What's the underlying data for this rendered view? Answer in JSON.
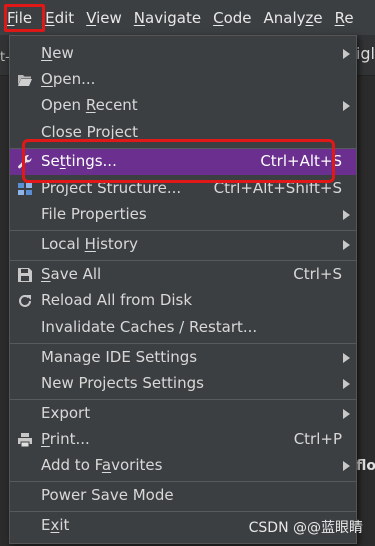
{
  "menubar": {
    "items": [
      {
        "name": "file",
        "label": "File",
        "mnemonic": "F",
        "rest": "ile"
      },
      {
        "name": "edit",
        "label": "Edit",
        "mnemonic": "E",
        "rest": "dit"
      },
      {
        "name": "view",
        "label": "View",
        "mnemonic": "V",
        "rest": "iew"
      },
      {
        "name": "navigate",
        "label": "Navigate",
        "mnemonic": "N",
        "rest": "avigate"
      },
      {
        "name": "code",
        "label": "Code",
        "mnemonic": "C",
        "rest": "ode"
      },
      {
        "name": "analyze",
        "label": "Analyze",
        "pre": "Analy",
        "mnemonic": "z",
        "rest": "e"
      },
      {
        "name": "re",
        "label": "Re",
        "mnemonic": "R",
        "rest": "e"
      }
    ]
  },
  "background": {
    "left_text": "t-",
    "right_text": "igl",
    "flo_text": "flo"
  },
  "file_menu": {
    "items": [
      {
        "label": "New",
        "pre": "",
        "mnem": "N",
        "post": "ew",
        "shortcut": "",
        "submenu": true
      },
      {
        "label": "Open...",
        "pre": "",
        "mnem": "O",
        "post": "pen...",
        "shortcut": "",
        "submenu": false,
        "icon": "folder-open-icon"
      },
      {
        "label": "Open Recent",
        "pre": "Open ",
        "mnem": "R",
        "post": "ecent",
        "shortcut": "",
        "submenu": true
      },
      {
        "label": "Close Project",
        "pre": "Close Pro",
        "mnem": "j",
        "post": "ect",
        "shortcut": "",
        "submenu": false
      },
      {
        "label": "Settings...",
        "pre": "Se",
        "mnem": "t",
        "post": "tings...",
        "shortcut": "Ctrl+Alt+S",
        "submenu": false,
        "icon": "wrench-icon",
        "selected": true
      },
      {
        "label": "Project Structure...",
        "pre": "Project Structure...",
        "mnem": "",
        "post": "",
        "shortcut": "Ctrl+Alt+Shift+S",
        "submenu": false,
        "icon": "project-structure-icon"
      },
      {
        "label": "File Properties",
        "pre": "File Properties",
        "mnem": "",
        "post": "",
        "shortcut": "",
        "submenu": true
      },
      {
        "label": "Local History",
        "pre": "Local ",
        "mnem": "H",
        "post": "istory",
        "shortcut": "",
        "submenu": true
      },
      {
        "label": "Save All",
        "pre": "",
        "mnem": "S",
        "post": "ave All",
        "shortcut": "Ctrl+S",
        "submenu": false,
        "icon": "save-icon"
      },
      {
        "label": "Reload All from Disk",
        "pre": "Reload All from Disk",
        "mnem": "",
        "post": "",
        "shortcut": "",
        "submenu": false,
        "icon": "reload-icon"
      },
      {
        "label": "Invalidate Caches / Restart...",
        "pre": "Invalidate Caches / Restart...",
        "mnem": "",
        "post": "",
        "shortcut": "",
        "submenu": false
      },
      {
        "label": "Manage IDE Settings",
        "pre": "Manage IDE Settings",
        "mnem": "",
        "post": "",
        "shortcut": "",
        "submenu": true
      },
      {
        "label": "New Projects Settings",
        "pre": "New Projects Settings",
        "mnem": "",
        "post": "",
        "shortcut": "",
        "submenu": true
      },
      {
        "label": "Export",
        "pre": "Export",
        "mnem": "",
        "post": "",
        "shortcut": "",
        "submenu": true
      },
      {
        "label": "Print...",
        "pre": "",
        "mnem": "P",
        "post": "rint...",
        "shortcut": "Ctrl+P",
        "submenu": false,
        "icon": "printer-icon"
      },
      {
        "label": "Add to Favorites",
        "pre": "Add to F",
        "mnem": "a",
        "post": "vorites",
        "shortcut": "",
        "submenu": true
      },
      {
        "label": "Power Save Mode",
        "pre": "Power Save Mode",
        "mnem": "",
        "post": "",
        "shortcut": "",
        "submenu": false
      },
      {
        "label": "Exit",
        "pre": "E",
        "mnem": "x",
        "post": "it",
        "shortcut": "",
        "submenu": false
      }
    ]
  },
  "watermark": "CSDN @@蓝眼睛",
  "colors": {
    "menu_bg": "#3c3f41",
    "selection": "#6b2f8f",
    "highlight_box": "#e01818",
    "text": "#d8d8d8"
  }
}
